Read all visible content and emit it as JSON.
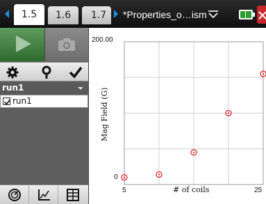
{
  "tabs": [
    {
      "label": "1.5",
      "active": true
    },
    {
      "label": "1.6",
      "active": false
    },
    {
      "label": "1.7",
      "active": false
    }
  ],
  "document": {
    "title": "*Properties_o…ism"
  },
  "icons": {
    "nav_left": "arrow-left-icon",
    "nav_right": "arrow-right-icon",
    "doc_menu": "chevron-down-icon",
    "battery": "battery-icon",
    "close": "close-icon",
    "play": "play-icon",
    "camera": "camera-icon",
    "tools": [
      "gear-icon",
      "pin-icon",
      "check-icon"
    ],
    "bottom": [
      "meter-icon",
      "graph-icon",
      "table-icon"
    ]
  },
  "run": {
    "header": "run1",
    "items": [
      {
        "label": "run1",
        "checked": true
      }
    ]
  },
  "chart_data": {
    "type": "scatter",
    "title": "",
    "xlabel": "# of coils",
    "ylabel": "Mag Field (G)",
    "xlim": [
      5,
      25
    ],
    "ylim": [
      0,
      200
    ],
    "x_tick_labels": [
      "5",
      "25"
    ],
    "y_tick_labels": [
      "0",
      "200.00"
    ],
    "grid": true,
    "marker_color": "#e0242a",
    "series": [
      {
        "x": [
          5,
          10,
          15,
          20,
          25
        ],
        "y": [
          10,
          14,
          45,
          100,
          155
        ]
      }
    ]
  }
}
